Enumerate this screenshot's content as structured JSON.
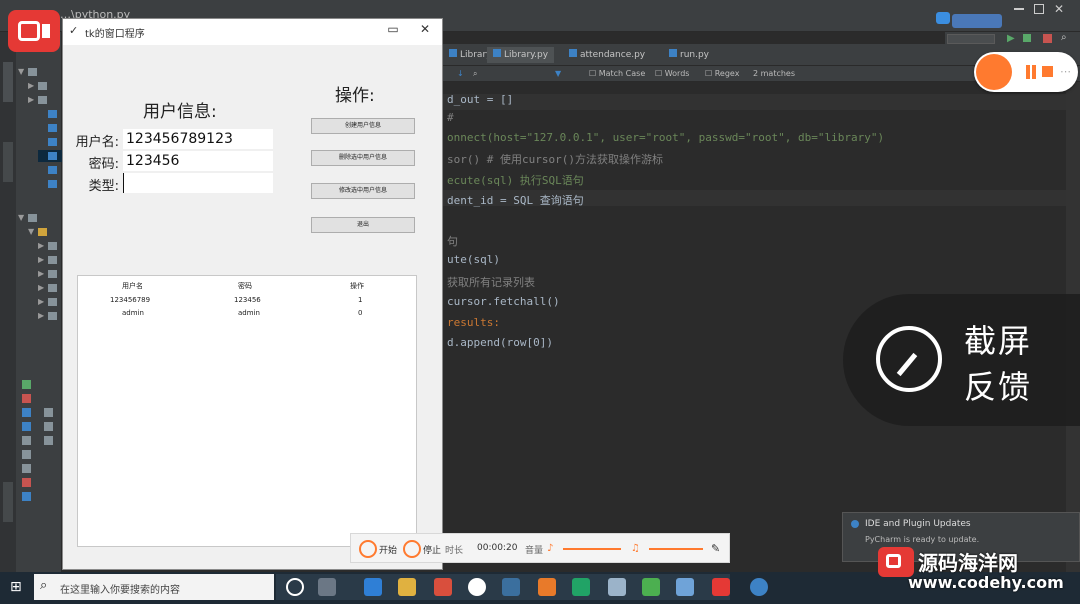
{
  "app_window": {
    "title": "tk的窗口程序",
    "user_info_heading": "用户信息:",
    "operations_heading": "操作:",
    "username_label": "用户名:",
    "password_label": "密码:",
    "type_label": "类型:",
    "username_value": "123456789123",
    "password_value": "123456",
    "type_value": "",
    "buttons": [
      "创建用户信息",
      "删除选中用户信息",
      "修改选中用户信息",
      "退出"
    ],
    "table": {
      "headers": [
        "用户名",
        "密码",
        "操作"
      ],
      "rows": [
        [
          "123456789",
          "123456",
          "1"
        ],
        [
          "admin",
          "admin",
          "0"
        ]
      ]
    }
  },
  "ide": {
    "window_title": "…\\python.py",
    "tabs": [
      "Library.py",
      "attendance.py",
      "run.py"
    ],
    "find_options": [
      "Match Case",
      "Words",
      "Regex"
    ],
    "find_result": "2 matches",
    "code_lines": [
      "d_out = []",
      "#",
      "onnect(host=\"127.0.0.1\", user=\"root\", passwd=\"root\", db=\"library\")",
      "sor()  # 使用cursor()方法获取操作游标",
      "ecute(sql) 执行SQL语句",
      "dent_id  = SQL 查询语句",
      "",
      "句",
      "ute(sql)",
      "获取所有记录列表",
      "cursor.fetchall()",
      "results:",
      "d.append(row[0])"
    ]
  },
  "screenshot_feedback": {
    "line1": "截屏",
    "line2": "反馈"
  },
  "recording_bar": {
    "start_label": "开始",
    "stop_label": "停止",
    "time_label": "时长",
    "time": "00:00:20",
    "volume_label": "音量"
  },
  "notification": {
    "title": "IDE and Plugin Updates",
    "body": "PyCharm is ready to update."
  },
  "taskbar": {
    "search_placeholder": "在这里输入你要搜索的内容"
  },
  "watermark": {
    "line1": "源码海洋网",
    "line2": "www.codehy.com"
  },
  "colors": {
    "ide_bg": "#2b2b2b",
    "accent_orange": "#ff7a2f",
    "record_red": "#e53935"
  }
}
